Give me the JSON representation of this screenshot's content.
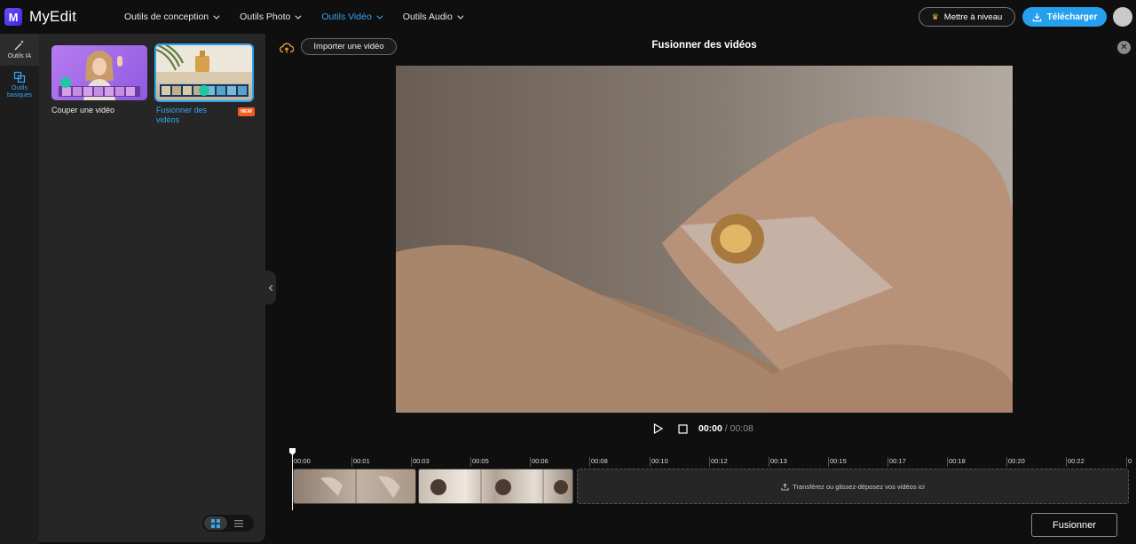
{
  "app": {
    "name": "MyEdit",
    "logo_letter": "M"
  },
  "nav": {
    "items": [
      {
        "label": "Outils de conception",
        "active": false
      },
      {
        "label": "Outils Photo",
        "active": false
      },
      {
        "label": "Outils Vidéo",
        "active": true
      },
      {
        "label": "Outils Audio",
        "active": false
      }
    ]
  },
  "header": {
    "upgrade_label": "Mettre à niveau",
    "download_label": "Télécharger"
  },
  "rail": {
    "items": [
      {
        "label": "Outils IA",
        "icon": "magic-wand-icon"
      },
      {
        "label": "Outils basiques",
        "icon": "copy-squares-icon",
        "active": true
      }
    ]
  },
  "panel": {
    "cards": [
      {
        "label": "Couper une vidéo",
        "selected": false
      },
      {
        "label": "Fusionner des vidéos",
        "selected": true,
        "badge": "NEW"
      }
    ]
  },
  "main": {
    "import_label": "Importer une vidéo",
    "title": "Fusionner des vidéos",
    "current_time": "00:00",
    "total_time": "/ 00:08",
    "dropzone_label": "Transférez ou glissez-déposez vos vidéos ici",
    "merge_label": "Fusionner"
  },
  "timeline": {
    "ticks": [
      "00:00",
      "00:01",
      "00:03",
      "00:05",
      "00:06",
      "00:08",
      "00:10",
      "00:12",
      "00:13",
      "00:15",
      "00:17",
      "00:18",
      "00:20",
      "00:22",
      "0"
    ]
  },
  "colors": {
    "accent": "#36a6f5",
    "download": "#25a0ee",
    "badge": "#f25d1b",
    "background": "#0f0f0f",
    "panel": "#262626"
  }
}
